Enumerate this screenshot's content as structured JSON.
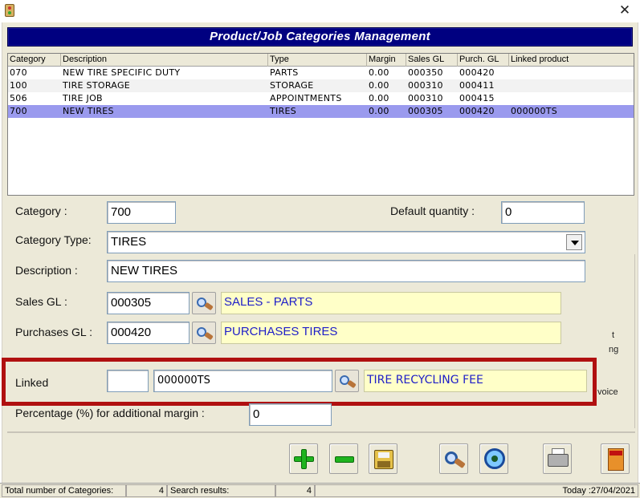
{
  "window": {
    "close_glyph": "✕",
    "header_title": "Product/Job Categories Management"
  },
  "grid": {
    "columns": [
      "Category",
      "Description",
      "Type",
      "Margin",
      "Sales GL",
      "Purch. GL",
      "Linked product"
    ],
    "rows": [
      {
        "category": "070",
        "description": "NEW TIRE SPECIFIC DUTY",
        "type": "PARTS",
        "margin": "0.00",
        "sales_gl": "000350",
        "purch_gl": "000420",
        "linked": ""
      },
      {
        "category": "100",
        "description": "TIRE STORAGE",
        "type": "STORAGE",
        "margin": "0.00",
        "sales_gl": "000310",
        "purch_gl": "000411",
        "linked": ""
      },
      {
        "category": "506",
        "description": "TIRE JOB",
        "type": "APPOINTMENTS",
        "margin": "0.00",
        "sales_gl": "000310",
        "purch_gl": "000415",
        "linked": ""
      },
      {
        "category": "700",
        "description": "NEW TIRES",
        "type": "TIRES",
        "margin": "0.00",
        "sales_gl": "000305",
        "purch_gl": "000420",
        "linked": "000000TS"
      }
    ],
    "selected_index": 3
  },
  "form": {
    "category_label": "Category :",
    "category_value": "700",
    "default_qty_label": "Default quantity :",
    "default_qty_value": "0",
    "category_type_label": "Category Type:",
    "category_type_value": "TIRES",
    "description_label": "Description :",
    "description_value": "NEW TIRES",
    "sales_gl_label": "Sales GL :",
    "sales_gl_value": "000305",
    "sales_gl_name": "SALES - PARTS",
    "purchases_gl_label": "Purchases GL :",
    "purchases_gl_value": "000420",
    "purchases_gl_name": "PURCHASES TIRES",
    "linked_label": "Linked",
    "linked_prefix_value": "",
    "linked_code_value": "000000TS",
    "linked_name": "TIRE RECYCLING FEE",
    "percentage_label": "Percentage (%) for additional margin :",
    "percentage_value": "0",
    "cut_text_1": "t",
    "cut_text_2": "ng",
    "cut_text_3": "voice"
  },
  "icons": {
    "add": "plus-icon",
    "remove": "minus-icon",
    "save": "floppy-disk-icon",
    "lookup": "magnifier-icon",
    "find": "find-icon",
    "print": "printer-icon",
    "exit": "exit-door-icon"
  },
  "colors": {
    "header_bg": "#000080",
    "selected_row": "#9a9aee",
    "highlight_border": "#b01010",
    "lookup_field_bg": "#ffffc8",
    "lookup_field_text": "#2020c8",
    "button_green": "#1fb41f"
  },
  "status": {
    "total_label": "Total number of Categories:",
    "total_value": "4",
    "search_label": "Search results:",
    "search_value": "4",
    "today": "Today :27/04/2021"
  }
}
